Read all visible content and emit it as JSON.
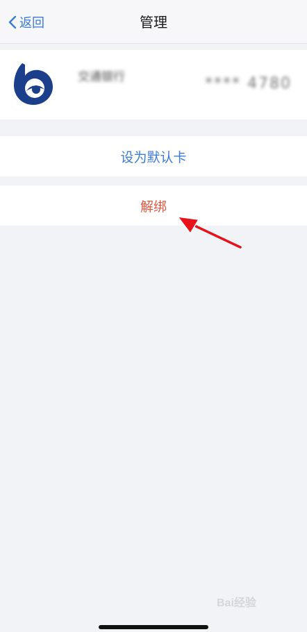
{
  "navbar": {
    "back_label": "返回",
    "title": "管理"
  },
  "card": {
    "bank_name": "交通银行",
    "card_number": "**** 4780"
  },
  "actions": {
    "set_default_label": "设为默认卡",
    "unbind_label": "解绑"
  },
  "watermark": {
    "text": "Bai经验"
  },
  "colors": {
    "link_blue": "#3a7bd5",
    "destructive_red": "#e5573f",
    "annotation_red": "#e8121b",
    "bank_logo_blue": "#1b3f8b"
  }
}
